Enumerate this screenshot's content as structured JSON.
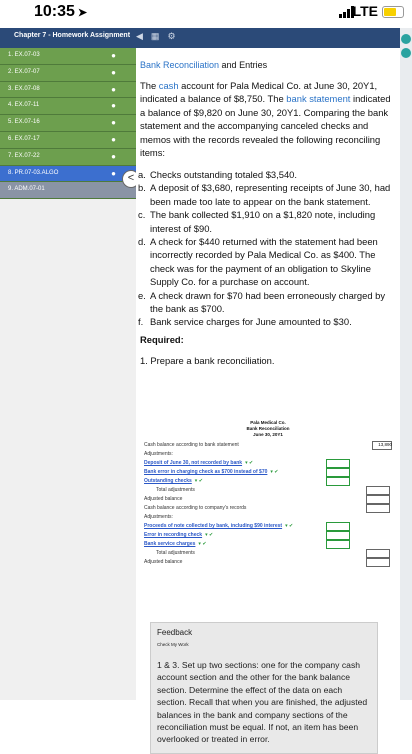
{
  "status_bar": {
    "time": "10:35",
    "network": "LTE"
  },
  "header": {
    "title": "Chapter 7 - Homework Assignment",
    "tools": [
      "◀",
      "▦",
      "⚙"
    ]
  },
  "sidebar": {
    "items": [
      {
        "label": "1. EX.07-03",
        "style": "green"
      },
      {
        "label": "2. EX.07-07",
        "style": "green"
      },
      {
        "label": "3. EX.07-08",
        "style": "green"
      },
      {
        "label": "4. EX.07-11",
        "style": "green"
      },
      {
        "label": "5. EX.07-16",
        "style": "green"
      },
      {
        "label": "6. EX.07-17",
        "style": "green"
      },
      {
        "label": "7. EX.07-22",
        "style": "green"
      },
      {
        "label": "8. PR.07-03.ALGO",
        "style": "active"
      },
      {
        "label": "9. ADM.07-01",
        "style": "gray"
      }
    ]
  },
  "content": {
    "title_blue": "Bank Reconciliation",
    "title_plain": " and Entries",
    "intro": {
      "p1": "The ",
      "cash": "cash",
      "p2": " account for Pala Medical Co. at June 30, 20Y1, indicated a balance of $8,750. The ",
      "bank_statement": "bank statement",
      "p3": " indicated a balance of $9,820 on June 30, 20Y1. Comparing the bank statement and the accompanying canceled checks and memos with the records revealed the following reconciling items:"
    },
    "items": [
      {
        "m": "a.",
        "t": "Checks outstanding totaled $3,540."
      },
      {
        "m": "b.",
        "t": "A deposit of $3,680, representing receipts of June 30, had been made too late to appear on the bank statement."
      },
      {
        "m": "c.",
        "t": "The bank collected $1,910 on a $1,820 note, including interest of $90."
      },
      {
        "m": "d.",
        "t": "A check for $440 returned with the statement had been incorrectly recorded by Pala Medical Co. as $400. The check was for the payment of an obligation to Skyline Supply Co. for a purchase on account."
      },
      {
        "m": "e.",
        "t": "A check drawn for $70 had been erroneously charged by the bank as $700."
      },
      {
        "m": "f.",
        "t": "Bank service charges for June amounted to $30."
      }
    ],
    "required": "Required:",
    "q1": "1.  Prepare a bank reconciliation."
  },
  "reconciliation": {
    "company": "Pala Medical Co.",
    "title": "Bank Reconciliation",
    "date": "June 30, 20Y1",
    "rows": [
      {
        "label": "Cash balance according to bank statement",
        "amount": "13,890"
      },
      {
        "label": "Adjustments:"
      },
      {
        "label": "Deposit of June 30, not recorded by bank",
        "link": true
      },
      {
        "label": "Bank error in charging check as $700 instead of $70",
        "link": true
      },
      {
        "label": "Outstanding checks",
        "link": true
      },
      {
        "label": "Total adjustments"
      },
      {
        "label": "Adjusted balance"
      },
      {
        "label": "Cash balance according to company's records"
      },
      {
        "label": "Adjustments:"
      },
      {
        "label": "Proceeds of note collected by bank, including $90 interest",
        "link": true
      },
      {
        "label": "Error in recording check",
        "link": true
      },
      {
        "label": "Bank service charges",
        "link": true
      },
      {
        "label": "Total adjustments"
      },
      {
        "label": "Adjusted balance"
      }
    ]
  },
  "feedback": {
    "header": "Feedback",
    "check": "Check My Work",
    "body": "1 & 3. Set up two sections: one for the company cash account section and the other for the bank balance section. Determine the effect of the data on each section. Recall that when you are finished, the adjusted balances in the bank and company sections of the reconciliation must be equal. If not, an item has been overlooked or treated in error."
  }
}
